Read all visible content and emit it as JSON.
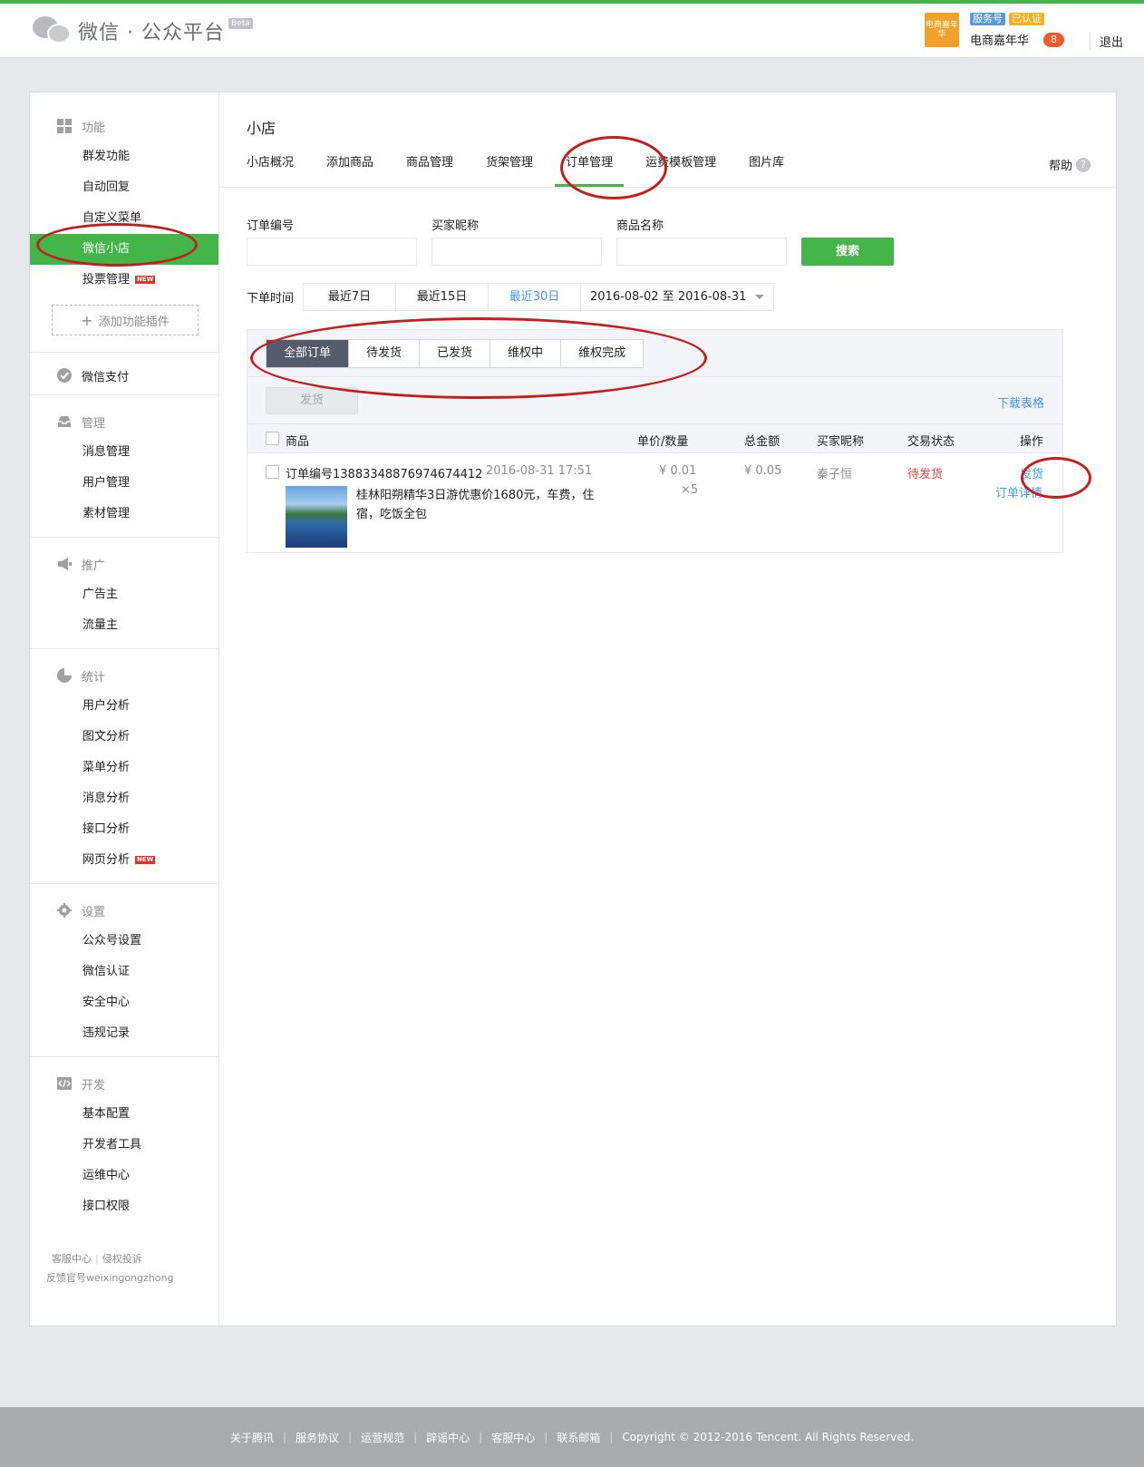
{
  "header": {
    "logo_text": "微信 · 公众平台",
    "beta": "Beta",
    "avatar_text": "电商嘉年华",
    "badge_service": "服务号",
    "badge_verified": "已认证",
    "account_name": "电商嘉年华",
    "message_count": "8",
    "logout": "退出"
  },
  "sidebar": {
    "groups": [
      {
        "head": "功能",
        "items": [
          "群发功能",
          "自动回复",
          "自定义菜单",
          "微信小店",
          "投票管理"
        ]
      },
      {
        "head": "微信支付"
      },
      {
        "head": "管理",
        "items": [
          "消息管理",
          "用户管理",
          "素材管理"
        ]
      },
      {
        "head": "推广",
        "items": [
          "广告主",
          "流量主"
        ]
      },
      {
        "head": "统计",
        "items": [
          "用户分析",
          "图文分析",
          "菜单分析",
          "消息分析",
          "接口分析",
          "网页分析"
        ]
      },
      {
        "head": "设置",
        "items": [
          "公众号设置",
          "微信认证",
          "安全中心",
          "违规记录"
        ]
      },
      {
        "head": "开发",
        "items": [
          "基本配置",
          "开发者工具",
          "运维中心",
          "接口权限"
        ]
      }
    ],
    "new_tag": "NEW",
    "add_plugin": "添加功能插件",
    "footer_line1_a": "客服中心",
    "footer_line1_b": "侵权投诉",
    "footer_line2": "反馈官号weixingongzhong"
  },
  "content": {
    "title": "小店",
    "tabs": [
      "小店概况",
      "添加商品",
      "商品管理",
      "货架管理",
      "订单管理",
      "运费模板管理",
      "图片库"
    ],
    "help": "帮助",
    "filters": {
      "order_no_label": "订单编号",
      "buyer_label": "买家昵称",
      "product_label": "商品名称",
      "search_button": "搜索",
      "time_label": "下单时间",
      "time_options": [
        "最近7日",
        "最近15日",
        "最近30日"
      ],
      "date_range": "2016-08-02 至 2016-08-31"
    },
    "status_tabs": [
      "全部订单",
      "待发货",
      "已发货",
      "维权中",
      "维权完成"
    ],
    "ship_button": "发货",
    "download": "下载表格",
    "columns": {
      "product": "商品",
      "price_qty": "单价/数量",
      "total": "总金额",
      "buyer": "买家昵称",
      "status": "交易状态",
      "action": "操作"
    },
    "order": {
      "order_no": "订单编号13883348876974674412",
      "time": "2016-08-31 17:51",
      "product_name": "桂林阳朔精华3日游优惠价1680元，车费，住宿，吃饭全包",
      "price": "¥ 0.01",
      "qty": "×5",
      "total": "¥ 0.05",
      "buyer": "秦子恒",
      "status": "待发货",
      "op_ship": "发货",
      "op_detail": "订单详情"
    }
  },
  "footer": {
    "links": [
      "关于腾讯",
      "服务协议",
      "运营规范",
      "辟谣中心",
      "客服中心",
      "联系邮箱"
    ],
    "copyright": "Copyright © 2012-2016 Tencent. All Rights Reserved."
  }
}
